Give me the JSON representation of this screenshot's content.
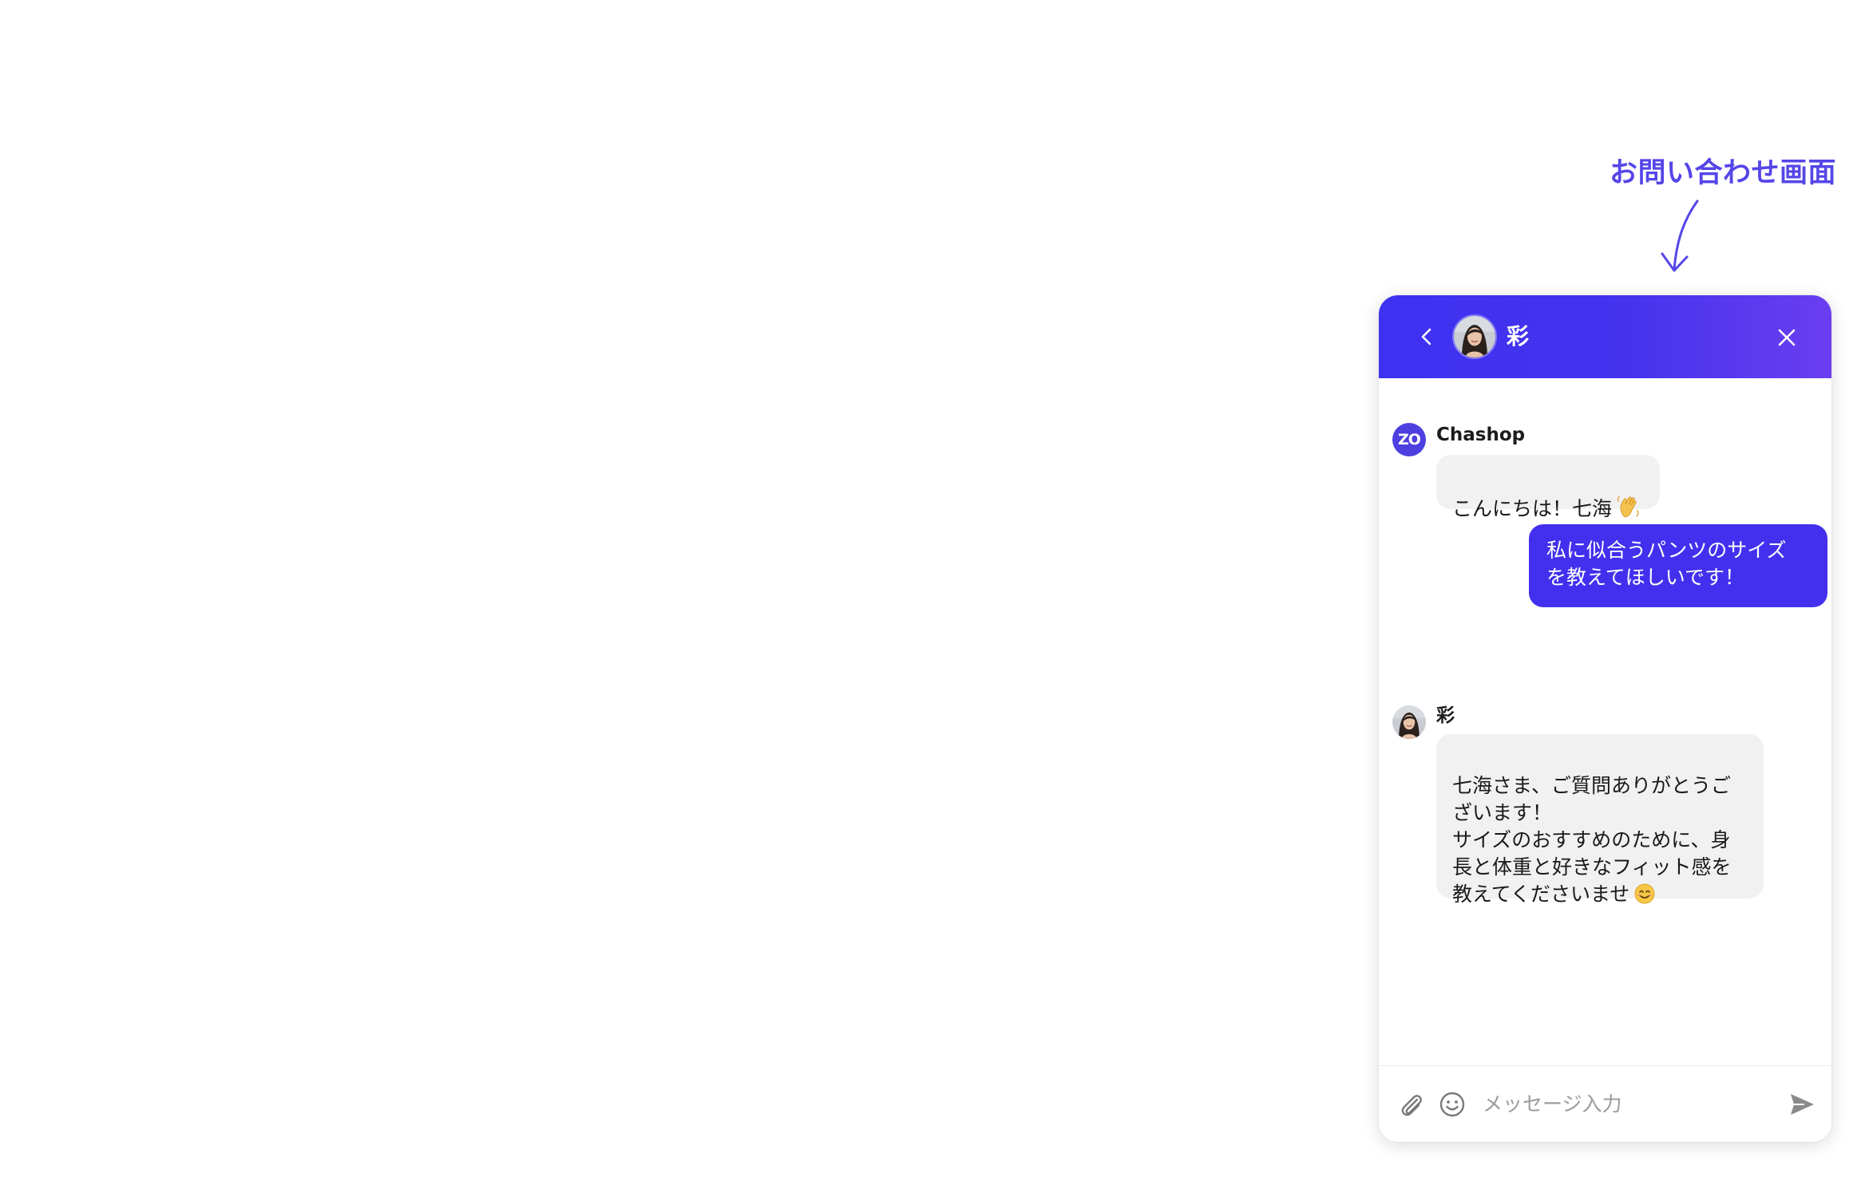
{
  "annotation": {
    "label": "お問い合わせ画面"
  },
  "chat": {
    "header": {
      "agent_name": "彩",
      "back_icon": "chevron-left-icon",
      "close_icon": "close-icon"
    },
    "messages": [
      {
        "sender": "Chashop",
        "avatar_text": "ZO",
        "direction": "incoming",
        "text": "こんにちは！七海",
        "emoji": "waving-hand"
      },
      {
        "direction": "outgoing",
        "text": "私に似合うパンツのサイズ\nを教えてほしいです！"
      },
      {
        "sender": "彩",
        "direction": "incoming",
        "text": "七海さま、ご質問ありがとうご\nざいます！\nサイズのおすすめのために、身\n長と体重と好きなフィット感を\n教えてくださいませ",
        "emoji": "smiling-face"
      }
    ],
    "footer": {
      "placeholder": "メッセージ入力",
      "attach_icon": "paperclip-icon",
      "emoji_icon": "smiley-icon",
      "send_icon": "send-icon"
    }
  },
  "colors": {
    "accent": "#4330ee",
    "annotation": "#5546e8",
    "incoming_bubble": "#f1f1f2"
  }
}
